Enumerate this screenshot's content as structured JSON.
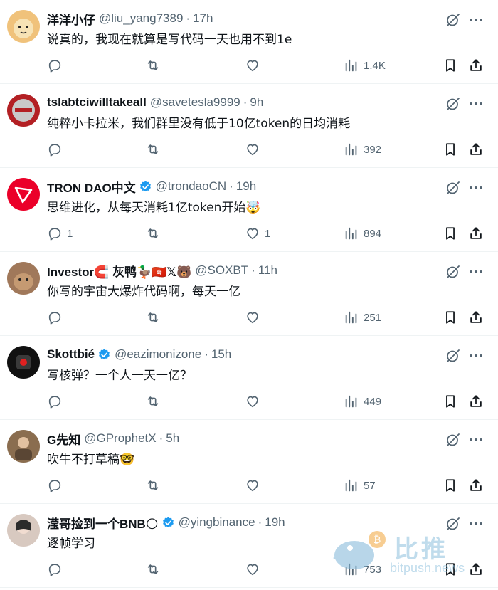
{
  "replies": [
    {
      "name": "洋洋小仔",
      "handle": "@liu_yang7389",
      "time": "17h",
      "text": "说真的，我现在就算是写代码一天也用不到1e",
      "reply_count": "",
      "like_count": "",
      "views": "1.4K",
      "verified": false,
      "name_emoji": "",
      "avatar_color": "#f0c27b"
    },
    {
      "name": "tslabtciwilltakeall",
      "handle": "@savetesla9999",
      "time": "9h",
      "text": "纯粹小卡拉米，我们群里没有低于10亿token的日均消耗",
      "reply_count": "",
      "like_count": "",
      "views": "392",
      "verified": false,
      "name_emoji": "",
      "avatar_color": "#b32024"
    },
    {
      "name": "TRON DAO中文",
      "handle": "@trondaoCN",
      "time": "19h",
      "text": "思维进化，从每天消耗1亿token开始🤯",
      "reply_count": "1",
      "like_count": "1",
      "views": "894",
      "verified": true,
      "name_emoji": "",
      "avatar_color": "#eb0029"
    },
    {
      "name": "Investor🧲 灰鸭🦆🇭🇰𝕏🐻",
      "handle": "@SOXBT",
      "time": "11h",
      "text": "你写的宇宙大爆炸代码啊，每天一亿",
      "reply_count": "",
      "like_count": "",
      "views": "251",
      "verified": false,
      "name_emoji": "",
      "avatar_color": "#a0785a"
    },
    {
      "name": "Skottbié",
      "handle": "@eazimonizone",
      "time": "15h",
      "text": "写核弹？一个人一天一亿？",
      "reply_count": "",
      "like_count": "",
      "views": "449",
      "verified": true,
      "name_emoji": "",
      "avatar_color": "#111111"
    },
    {
      "name": "G先知",
      "handle": "@GProphetX",
      "time": "5h",
      "text": "吹牛不打草稿🤓",
      "reply_count": "",
      "like_count": "",
      "views": "57",
      "verified": false,
      "name_emoji": "",
      "avatar_color": "#8a6d4f"
    },
    {
      "name": "滢哥捡到一个BNB🌕",
      "handle": "@yingbinance",
      "time": "19h",
      "text": "逐帧学习",
      "reply_count": "",
      "like_count": "",
      "views": "753",
      "verified": true,
      "name_emoji": "",
      "avatar_color": "#d8c9c0"
    }
  ],
  "icons": {
    "reply": "reply-icon",
    "retweet": "retweet-icon",
    "like": "like-icon",
    "views": "views-icon",
    "bookmark": "bookmark-icon",
    "share": "share-icon",
    "grok": "grok-icon",
    "more": "more-icon"
  },
  "colors": {
    "text": "#0f1419",
    "muted": "#536471",
    "verified": "#1d9bf0",
    "divider": "#eff3f4"
  },
  "watermark": {
    "cn": "比推",
    "en": "bitpush.news"
  }
}
